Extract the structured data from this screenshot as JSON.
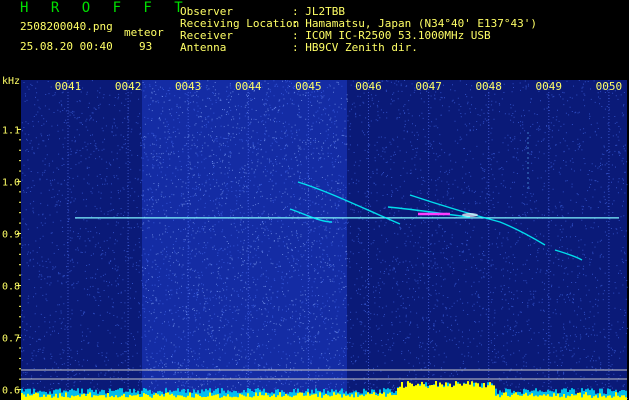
{
  "header": {
    "app_title": "H R O F F T",
    "filename": "2508200040.png",
    "mode": "meteor",
    "datetime": "25.08.20 00:40",
    "count": "93",
    "info_labels": [
      "Observer",
      "Receiving Location",
      "Receiver",
      "Antenna"
    ],
    "info_values": [
      ": JL2TBB",
      ": Hamamatsu, Japan (N34°40' E137°43')",
      ": ICOM IC-R2500 53.1000MHz USB",
      ": HB9CV Zenith dir."
    ]
  },
  "spectrogram": {
    "freq_unit": "kHz",
    "y_ticks": [
      {
        "label": "1.1",
        "v": 1.1
      },
      {
        "label": "1.0",
        "v": 1.0
      },
      {
        "label": "0.9",
        "v": 0.9
      },
      {
        "label": "0.8",
        "v": 0.8
      },
      {
        "label": "0.7",
        "v": 0.7
      },
      {
        "label": "0.6",
        "v": 0.6
      }
    ],
    "y_range_khz": [
      0.58,
      1.195
    ],
    "time_labels": [
      "0041",
      "0042",
      "0043",
      "0044",
      "0045",
      "0046",
      "0047",
      "0048",
      "0049",
      "0050"
    ],
    "carrier_khz": 0.93,
    "colors": {
      "background": "#0a1a78",
      "bright_band": "#1e3cc8",
      "carrier": "#7ff5ff",
      "signal": "#00ffff",
      "core": "#ff3cff",
      "tick_text": "#ffff66",
      "level_fill": "#ffff00",
      "level_alt": "#00d8ff"
    }
  }
}
